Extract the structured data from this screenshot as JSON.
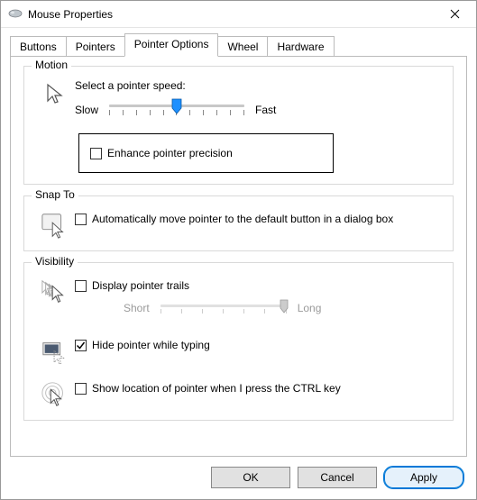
{
  "window": {
    "title": "Mouse Properties"
  },
  "tabs": {
    "buttons": "Buttons",
    "pointers": "Pointers",
    "pointer_options": "Pointer Options",
    "wheel": "Wheel",
    "hardware": "Hardware",
    "active": "pointer_options"
  },
  "motion": {
    "title": "Motion",
    "select_label": "Select a pointer speed:",
    "slow": "Slow",
    "fast": "Fast",
    "speed_value": 5,
    "speed_max": 10,
    "enhance_label": "Enhance pointer precision",
    "enhance_checked": false
  },
  "snap": {
    "title": "Snap To",
    "auto_label": "Automatically move pointer to the default button in a dialog box",
    "auto_checked": false
  },
  "visibility": {
    "title": "Visibility",
    "trails_label": "Display pointer trails",
    "trails_checked": false,
    "short": "Short",
    "long": "Long",
    "hide_label": "Hide pointer while typing",
    "hide_checked": true,
    "ctrl_label": "Show location of pointer when I press the CTRL key",
    "ctrl_checked": false
  },
  "buttons_row": {
    "ok": "OK",
    "cancel": "Cancel",
    "apply": "Apply"
  }
}
